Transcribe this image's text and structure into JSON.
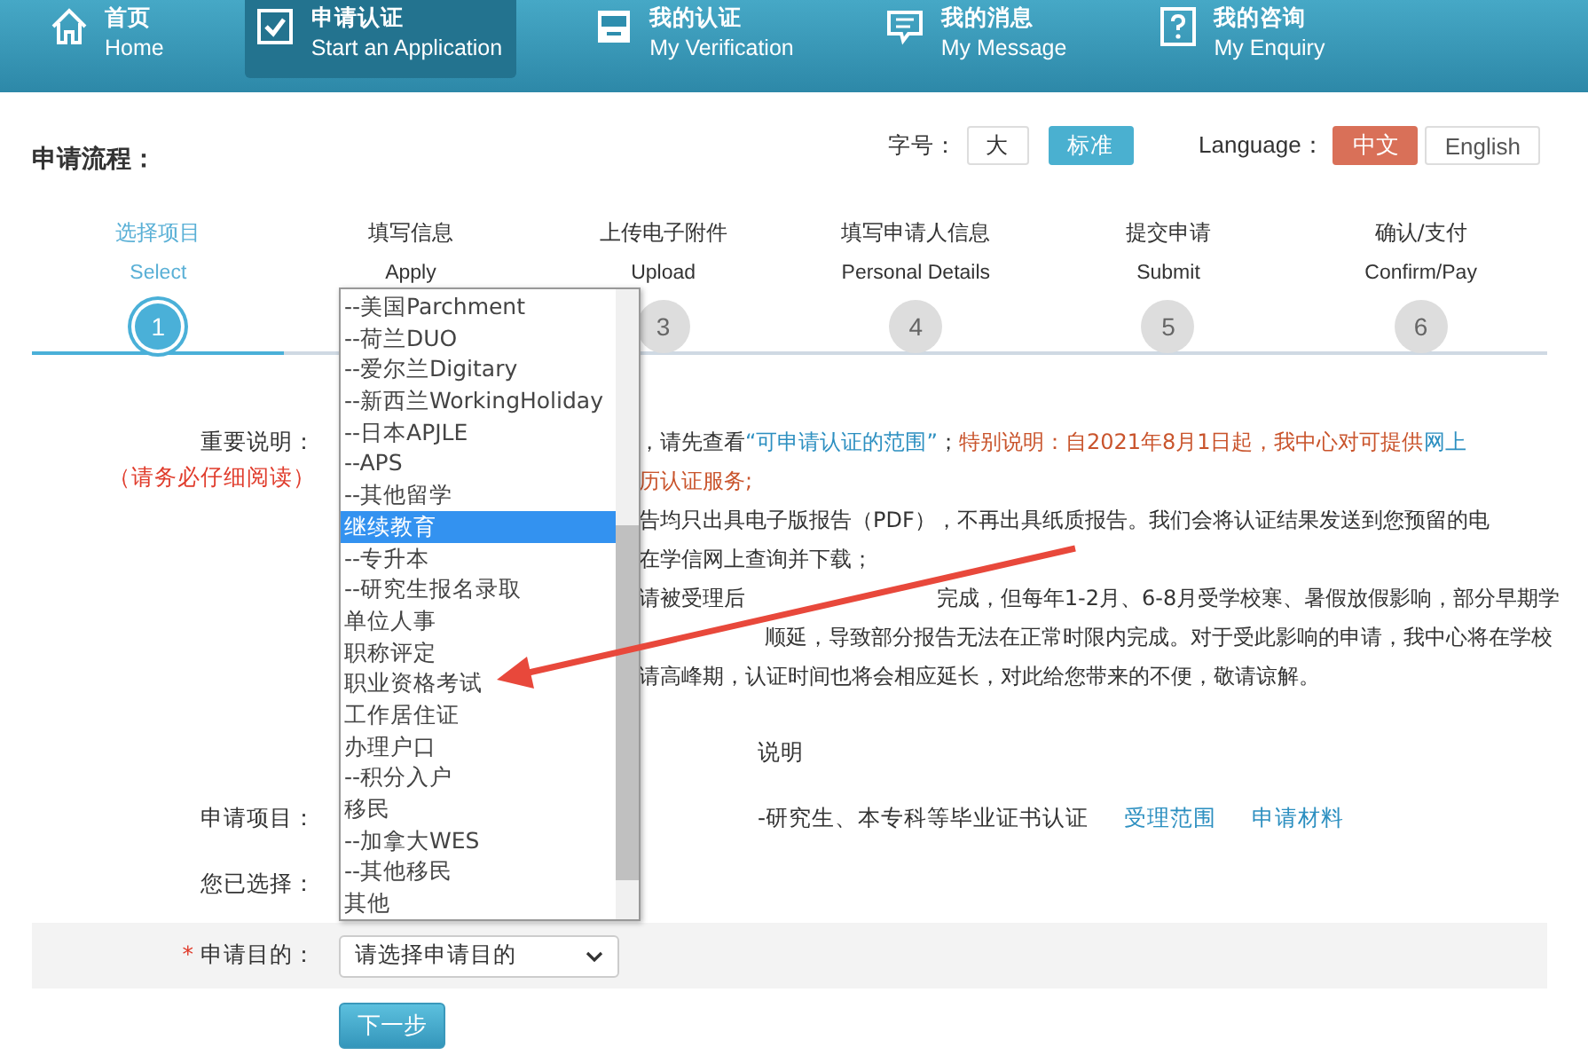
{
  "nav": [
    {
      "label_cn": "首页",
      "label_en": "Home",
      "selected": false
    },
    {
      "label_cn": "申请认证",
      "label_en": "Start an Application",
      "selected": true
    },
    {
      "label_cn": "我的认证",
      "label_en": "My Verification",
      "selected": false
    },
    {
      "label_cn": "我的消息",
      "label_en": "My Message",
      "selected": false
    },
    {
      "label_cn": "我的咨询",
      "label_en": "My Enquiry",
      "selected": false
    }
  ],
  "toolbar": {
    "font_label": "字号：",
    "font_sizes": [
      {
        "label": "大",
        "selected": false
      },
      {
        "label": "标准",
        "selected": true
      }
    ],
    "language_label": "Language：",
    "languages": [
      {
        "label": "中文",
        "selected": true
      },
      {
        "label": "English",
        "selected": false
      }
    ]
  },
  "page_title": "申请流程：",
  "steps": [
    {
      "title": "选择项目",
      "subtitle": "Select",
      "number": "1",
      "selected": true
    },
    {
      "title": "填写信息",
      "subtitle": "Apply",
      "selected": false
    },
    {
      "title": "上传电子附件",
      "subtitle": "Upload",
      "number": "3",
      "selected": false
    },
    {
      "title": "填写申请人信息",
      "subtitle": "Personal Details",
      "number": "4",
      "selected": false
    },
    {
      "title": "提交申请",
      "subtitle": "Submit",
      "number": "5",
      "selected": false
    },
    {
      "title": "确认/支付",
      "subtitle": "Confirm/Pay",
      "number": "6",
      "selected": false
    }
  ],
  "notes": {
    "label": "重要说明：",
    "hint": "（请务必仔细阅读）",
    "lines": [
      [
        {
          "kind": "plain",
          "text": "，请先查看"
        },
        {
          "kind": "link",
          "text": "“可申请认证的范围”"
        },
        {
          "kind": "plain",
          "text": "；"
        },
        {
          "kind": "warn",
          "text": "特别说明：自2021年8月1日起，我中心对可提供"
        },
        {
          "kind": "link",
          "text": "网上"
        }
      ],
      [
        {
          "kind": "warn",
          "text": "历认证服务;"
        }
      ],
      [
        {
          "kind": "plain",
          "text": "告均只出具电子版报告（PDF），不再出具纸质报告。我们会将认证结果发送到您预留的电"
        }
      ],
      [
        {
          "kind": "plain",
          "text": "在学信网上查询并下载；"
        }
      ],
      [
        {
          "kind": "plain",
          "text": "请被受理后"
        },
        {
          "kind": "plain",
          "text": "完成，但每年1-2月、6-8月受学校寒、暑假放假影响，部分早期学",
          "after_arrow": true
        }
      ],
      [
        {
          "kind": "plain",
          "text": "顺延，导致部分报告无法在正常时限内完成。对于受此影响的申请，我中心将在学校",
          "after_arrow": true
        }
      ],
      [
        {
          "kind": "plain",
          "text": "请高峰期，认证时间也将会相应延长，对此给您带来的不便，敬请谅解。"
        }
      ]
    ]
  },
  "table": {
    "header": "说明",
    "rows": [
      {
        "label": "申请项目：",
        "description": "-研究生、本专科等毕业证书认证",
        "links": [
          "受理范围",
          "申请材料"
        ]
      },
      {
        "label": "您已选择："
      }
    ]
  },
  "purpose": {
    "required_mark": "*",
    "label": "申请目的：",
    "value": "请选择申请目的"
  },
  "next_button": "下一步",
  "dropdown": {
    "options": [
      {
        "label": "--美国Parchment",
        "selected": false
      },
      {
        "label": "--荷兰DUO",
        "selected": false
      },
      {
        "label": "--爱尔兰Digitary",
        "selected": false
      },
      {
        "label": "--新西兰WorkingHoliday",
        "selected": false
      },
      {
        "label": "--日本APJLE",
        "selected": false
      },
      {
        "label": "--APS",
        "selected": false
      },
      {
        "label": "--其他留学",
        "selected": false
      },
      {
        "label": "继续教育",
        "selected": true
      },
      {
        "label": "--专升本",
        "selected": false
      },
      {
        "label": "--研究生报名录取",
        "selected": false
      },
      {
        "label": "单位人事",
        "selected": false
      },
      {
        "label": "职称评定",
        "selected": false
      },
      {
        "label": "职业资格考试",
        "selected": false
      },
      {
        "label": "工作居住证",
        "selected": false
      },
      {
        "label": "办理户口",
        "selected": false
      },
      {
        "label": "--积分入户",
        "selected": false
      },
      {
        "label": "移民",
        "selected": false
      },
      {
        "label": "--加拿大WES",
        "selected": false
      },
      {
        "label": "--其他移民",
        "selected": false
      },
      {
        "label": "其他",
        "selected": false
      }
    ]
  }
}
